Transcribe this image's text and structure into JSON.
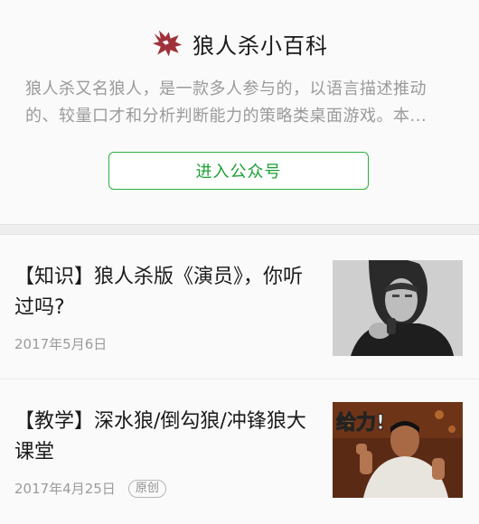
{
  "profile": {
    "account_name": "狼人杀小百科",
    "description": "狼人杀又名狼人，是一款多人参与的，以语言描述推动的、较量口才和分析判断能力的策略类桌面游戏。本...",
    "follow_button": "进入公众号",
    "logo_icon": "wolf-head-icon",
    "accent_color": "#1aa034"
  },
  "articles": [
    {
      "title": "【知识】狼人杀版《演员》，你听过吗?",
      "date": "2017年5月6日",
      "thumbnail": "grayscale-singer-photo"
    },
    {
      "title": "【教学】深水狼/倒勾狼/冲锋狼大课堂",
      "date": "2017年4月25日",
      "badge": "原创",
      "thumbnail_caption": "给力!",
      "thumbnail": "thumbs-up-meme-photo"
    }
  ]
}
